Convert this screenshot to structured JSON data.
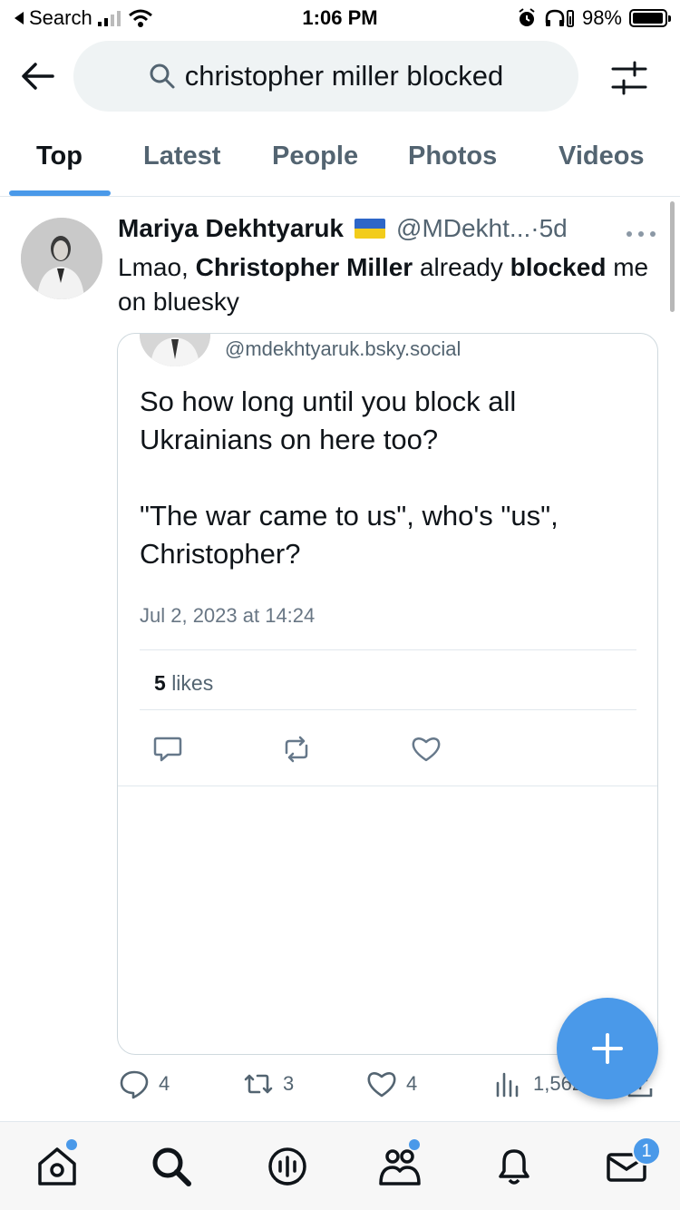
{
  "status_bar": {
    "back_app": "Search",
    "time": "1:06 PM",
    "battery": "98%",
    "battery_level": 0.98
  },
  "header": {
    "search_query": "christopher miller blocked",
    "back_icon": "arrow-left-icon",
    "search_icon": "magnifier-icon",
    "filter_icon": "sliders-icon"
  },
  "tabs": [
    {
      "label": "Top",
      "active": true
    },
    {
      "label": "Latest",
      "active": false
    },
    {
      "label": "People",
      "active": false
    },
    {
      "label": "Photos",
      "active": false
    },
    {
      "label": "Videos",
      "active": false
    }
  ],
  "tweet": {
    "author_name": "Mariya Dekhtyaruk",
    "flag": "ukraine-flag",
    "handle": "@MDekht...",
    "separator": "·",
    "age": "5d",
    "text_parts": [
      "Lmao, ",
      "Christopher Miller",
      " already ",
      "blocked",
      " me on bluesky"
    ],
    "embedded_post": {
      "handle": "@mdekhtyaruk.bsky.social",
      "text": "So how long until you block all Ukrainians on here too?\n\n\"The war came to us\", who's \"us\", Christopher?",
      "date": "Jul 2, 2023 at 14:24",
      "likes_count": "5",
      "likes_label": "likes"
    },
    "stats": {
      "replies": "4",
      "retweets": "3",
      "likes": "4",
      "views": "1,562"
    }
  },
  "bottom_nav": {
    "items": [
      "home-icon",
      "search-icon",
      "spaces-icon",
      "communities-icon",
      "notifications-icon",
      "messages-icon"
    ],
    "messages_badge": "1"
  },
  "colors": {
    "accent": "#4a99e9",
    "text": "#0f1419",
    "muted": "#536471",
    "border": "#cfd9de"
  }
}
